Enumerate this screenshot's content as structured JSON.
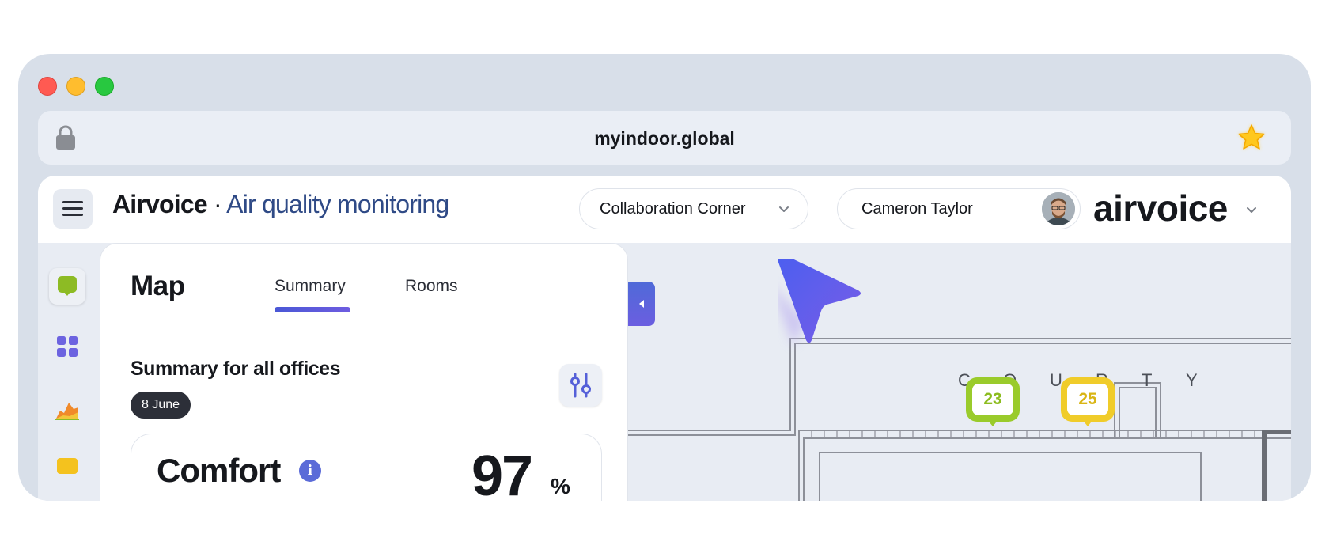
{
  "browser": {
    "url": "myindoor.global"
  },
  "header": {
    "brand_name": "Airvoice",
    "brand_separator": "·",
    "brand_subtitle": "Air quality monitoring",
    "office_selector": "Collaboration Corner",
    "user_name": "Cameron Taylor",
    "logo_text": "airvoice"
  },
  "panel": {
    "title": "Map",
    "tabs": [
      {
        "label": "Summary",
        "active": true
      },
      {
        "label": "Rooms",
        "active": false
      }
    ],
    "summary_title": "Summary for all offices",
    "date": "8 June",
    "card": {
      "title": "Comfort",
      "value": "97",
      "unit": "%"
    }
  },
  "floorplan": {
    "courtyard_letters": [
      "C",
      "O",
      "U",
      "R",
      "T",
      "Y"
    ],
    "pins": [
      {
        "value": "23",
        "status": "green",
        "color": "#9acb2b"
      },
      {
        "value": "25",
        "status": "yellow",
        "color": "#f0cc2a"
      }
    ]
  },
  "colors": {
    "accent": "#4a58d6",
    "brand_text": "#2f4a86"
  }
}
